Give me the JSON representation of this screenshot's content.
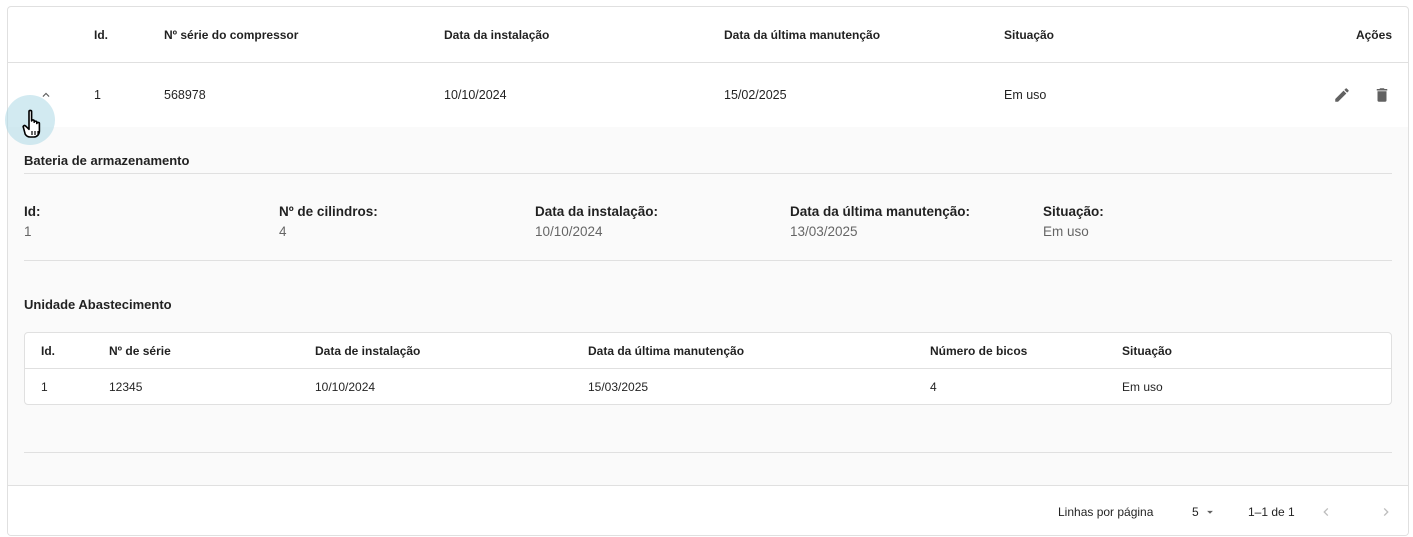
{
  "main_table": {
    "headers": {
      "id": "Id.",
      "compressor_serial": "Nº série do compressor",
      "install_date": "Data da instalação",
      "last_maintenance": "Data da última manutenção",
      "status": "Situação",
      "actions": "Ações"
    },
    "row": {
      "id": "1",
      "compressor_serial": "568978",
      "install_date": "10/10/2024",
      "last_maintenance": "15/02/2025",
      "status": "Em uso"
    }
  },
  "storage_section": {
    "title": "Bateria de armazenamento",
    "fields": {
      "id_label": "Id:",
      "id_value": "1",
      "cylinders_label": "Nº de cilindros:",
      "cylinders_value": "4",
      "install_label": "Data da instalação:",
      "install_value": "10/10/2024",
      "maintenance_label": "Data da última manutenção:",
      "maintenance_value": "13/03/2025",
      "status_label": "Situação:",
      "status_value": "Em uso"
    }
  },
  "supply_section": {
    "title": "Unidade Abastecimento",
    "headers": {
      "id": "Id.",
      "serial": "Nº de série",
      "install_date": "Data de instalação",
      "last_maintenance": "Data da última manutenção",
      "nozzles": "Número de bicos",
      "status": "Situação"
    },
    "row": {
      "id": "1",
      "serial": "12345",
      "install_date": "10/10/2024",
      "last_maintenance": "15/03/2025",
      "nozzles": "4",
      "status": "Em uso"
    }
  },
  "pagination": {
    "rows_per_page_label": "Linhas por página",
    "rows_per_page_value": "5",
    "range": "1–1 de 1"
  },
  "icons": {
    "expand": "chevron-up-icon",
    "edit": "pencil-icon",
    "delete": "trash-icon",
    "cursor": "hand-pointer-icon",
    "select_arrow": "caret-down-icon",
    "prev": "chevron-left-icon",
    "next": "chevron-right-icon"
  },
  "colors": {
    "text": "#212121",
    "icon": "#616161",
    "muted": "#757575",
    "divider": "#e0e0e0",
    "panel_bg": "#fafafa",
    "cursor_halo": "#add8e6"
  }
}
